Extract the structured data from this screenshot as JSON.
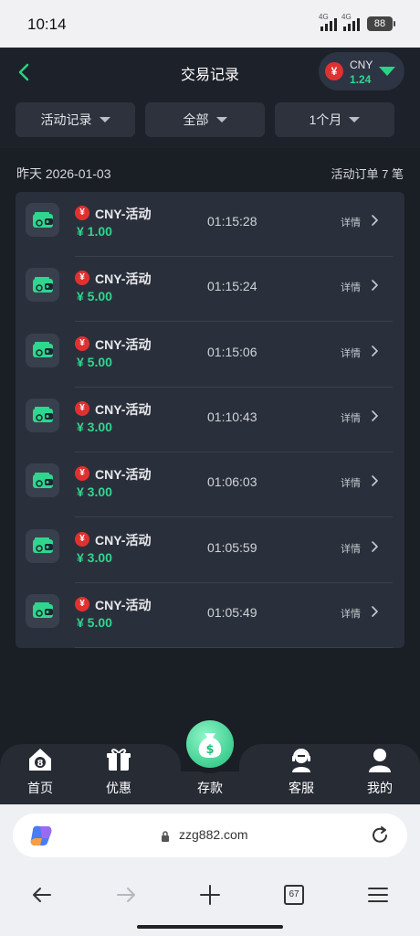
{
  "status_bar": {
    "time": "10:14",
    "network1": "4G",
    "network2": "4G",
    "battery": "88"
  },
  "header": {
    "title": "交易记录",
    "currency_code": "CNY",
    "balance": "1.24",
    "currency_symbol": "¥"
  },
  "filters": [
    {
      "label": "活动记录"
    },
    {
      "label": "全部"
    },
    {
      "label": "1个月"
    }
  ],
  "summary": {
    "date": "昨天 2026-01-03",
    "count_text": "活动订单 7 笔"
  },
  "records": [
    {
      "name": "CNY-活动",
      "amount": "¥ 1.00",
      "time": "01:15:28",
      "detail": "详情"
    },
    {
      "name": "CNY-活动",
      "amount": "¥ 5.00",
      "time": "01:15:24",
      "detail": "详情"
    },
    {
      "name": "CNY-活动",
      "amount": "¥ 5.00",
      "time": "01:15:06",
      "detail": "详情"
    },
    {
      "name": "CNY-活动",
      "amount": "¥ 3.00",
      "time": "01:10:43",
      "detail": "详情"
    },
    {
      "name": "CNY-活动",
      "amount": "¥ 3.00",
      "time": "01:06:03",
      "detail": "详情"
    },
    {
      "name": "CNY-活动",
      "amount": "¥ 3.00",
      "time": "01:05:59",
      "detail": "详情"
    },
    {
      "name": "CNY-活动",
      "amount": "¥ 5.00",
      "time": "01:05:49",
      "detail": "详情"
    }
  ],
  "nav": [
    {
      "label": "首页",
      "icon": "home-icon"
    },
    {
      "label": "优惠",
      "icon": "gift-icon"
    },
    {
      "label": "存款",
      "icon": "money-bag-icon"
    },
    {
      "label": "客服",
      "icon": "support-agent-icon"
    },
    {
      "label": "我的",
      "icon": "user-icon"
    }
  ],
  "browser": {
    "url": "zzg882.com",
    "tab_count": "67"
  },
  "colors": {
    "accent_green": "#2fd68e",
    "coin_red": "#e03131",
    "background": "#1a1e25",
    "card": "#2a303b"
  }
}
